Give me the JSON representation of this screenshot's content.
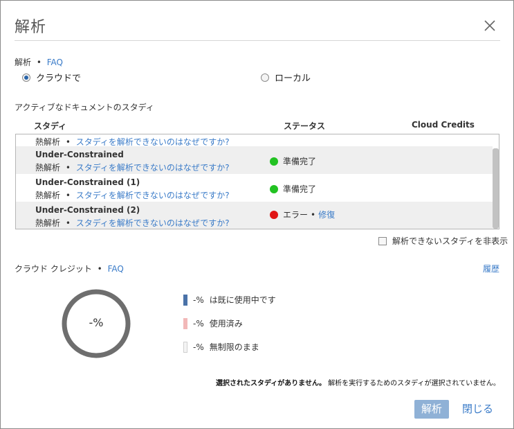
{
  "dialog": {
    "title": "解析",
    "close_icon": "close-icon"
  },
  "analysis": {
    "label": "解析",
    "sep": "•",
    "faq": "FAQ",
    "options": [
      {
        "label": "クラウドで",
        "selected": true
      },
      {
        "label": "ローカル",
        "selected": false
      }
    ]
  },
  "studies": {
    "section_label": "アクティブなドキュメントのスタディ",
    "columns": {
      "study": "スタディ",
      "status": "ステータス",
      "credits": "Cloud Credits"
    },
    "rows": [
      {
        "name": "",
        "type": "熱解析",
        "sep": "•",
        "link": "スタディを解析できないのはなぜですか?",
        "status": "",
        "status_action": ""
      },
      {
        "name": "Under-Constrained",
        "type": "熱解析",
        "sep": "•",
        "link": "スタディを解析できないのはなぜですか?",
        "status": "準備完了",
        "status_color": "#22c222",
        "status_action": ""
      },
      {
        "name": "Under-Constrained (1)",
        "type": "熱解析",
        "sep": "•",
        "link": "スタディを解析できないのはなぜですか?",
        "status": "準備完了",
        "status_color": "#22c222",
        "status_action": ""
      },
      {
        "name": "Under-Constrained (2)",
        "type": "熱解析",
        "sep": "•",
        "link": "スタディを解析できないのはなぜですか?",
        "status": "エラー",
        "status_color": "#e01515",
        "status_sep": "•",
        "status_action": "修復"
      }
    ],
    "hide_unanalyzable": {
      "label": "解析できないスタディを非表示",
      "checked": false
    }
  },
  "credits": {
    "label": "クラウド クレジット",
    "sep": "•",
    "faq": "FAQ",
    "history": "履歴",
    "gauge_value": "-%",
    "legend": [
      {
        "value": "-%",
        "label": "は既に使用中です",
        "color": "#4a72a8"
      },
      {
        "value": "-%",
        "label": "使用済み",
        "color": "#f2b8b8"
      },
      {
        "value": "-%",
        "label": "無制限のまま",
        "color": "#f4f4f4"
      }
    ]
  },
  "message": {
    "bold": "選択されたスタディがありません。",
    "rest": "解析を実行するためのスタディが選択されていません。"
  },
  "footer": {
    "analyze": "解析",
    "close": "閉じる"
  }
}
